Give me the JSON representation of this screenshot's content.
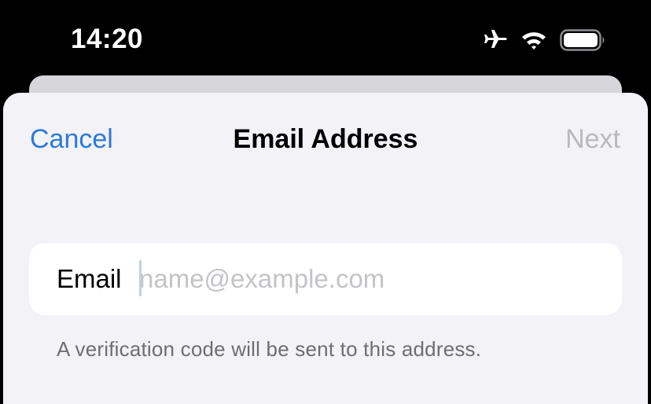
{
  "status_bar": {
    "time": "14:20",
    "icons": [
      "airplane-icon",
      "wifi-icon",
      "battery-icon"
    ]
  },
  "nav": {
    "cancel_label": "Cancel",
    "title": "Email Address",
    "next_label": "Next"
  },
  "form": {
    "email_label": "Email",
    "email_value": "",
    "email_placeholder": "name@example.com"
  },
  "footnote": "A verification code will be sent to this address.",
  "colors": {
    "accent": "#2e7ad6",
    "disabled": "#b8b8bd",
    "sheet_background": "#f2f2f7",
    "field_background": "#ffffff",
    "secondary_text": "#6d6d72"
  }
}
